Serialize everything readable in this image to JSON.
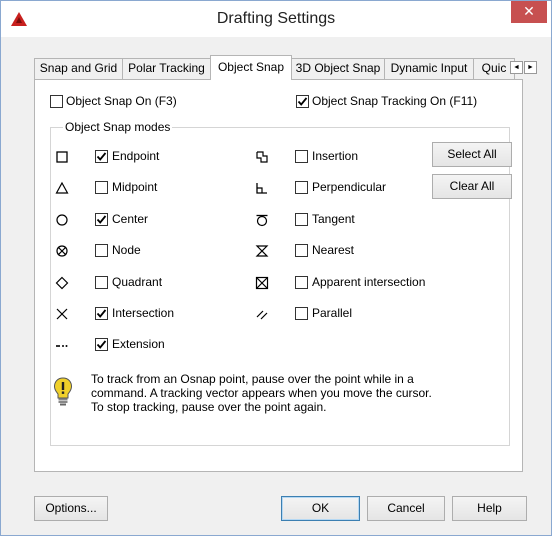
{
  "window": {
    "title": "Drafting Settings",
    "close": "✕"
  },
  "tabs": [
    {
      "label": "Snap and Grid"
    },
    {
      "label": "Polar Tracking"
    },
    {
      "label": "Object Snap"
    },
    {
      "label": "3D Object Snap"
    },
    {
      "label": "Dynamic Input"
    },
    {
      "label": "Quic"
    }
  ],
  "tab_scroll": {
    "left": "◄",
    "right": "►"
  },
  "top_options": {
    "snap_on": {
      "label": "Object Snap On (F3)",
      "checked": false
    },
    "tracking_on": {
      "label": "Object Snap Tracking On (F11)",
      "checked": true
    }
  },
  "modes": {
    "legend": "Object Snap modes",
    "left": [
      {
        "label": "Endpoint",
        "checked": true,
        "icon": "endpoint-marker-icon"
      },
      {
        "label": "Midpoint",
        "checked": false,
        "icon": "midpoint-marker-icon"
      },
      {
        "label": "Center",
        "checked": true,
        "icon": "center-marker-icon"
      },
      {
        "label": "Node",
        "checked": false,
        "icon": "node-marker-icon"
      },
      {
        "label": "Quadrant",
        "checked": false,
        "icon": "quadrant-marker-icon"
      },
      {
        "label": "Intersection",
        "checked": true,
        "icon": "intersection-marker-icon"
      },
      {
        "label": "Extension",
        "checked": true,
        "icon": "extension-marker-icon"
      }
    ],
    "right": [
      {
        "label": "Insertion",
        "checked": false,
        "icon": "insertion-marker-icon"
      },
      {
        "label": "Perpendicular",
        "checked": false,
        "icon": "perpendicular-marker-icon"
      },
      {
        "label": "Tangent",
        "checked": false,
        "icon": "tangent-marker-icon"
      },
      {
        "label": "Nearest",
        "checked": false,
        "icon": "nearest-marker-icon"
      },
      {
        "label": "Apparent intersection",
        "checked": false,
        "icon": "apparent-intersection-marker-icon"
      },
      {
        "label": "Parallel",
        "checked": false,
        "icon": "parallel-marker-icon"
      }
    ],
    "select_all": "Select All",
    "clear_all": "Clear All"
  },
  "info": {
    "line1": "To track from an Osnap point, pause over the point while in a",
    "line2": "command.  A tracking vector appears when you move the cursor.",
    "line3": "To stop tracking, pause over the point again."
  },
  "footer": {
    "options": "Options...",
    "ok": "OK",
    "cancel": "Cancel",
    "help": "Help"
  },
  "colors": {
    "close": "#c75050",
    "app_icon": "#c8201e",
    "bulb": "#f0d02a"
  }
}
